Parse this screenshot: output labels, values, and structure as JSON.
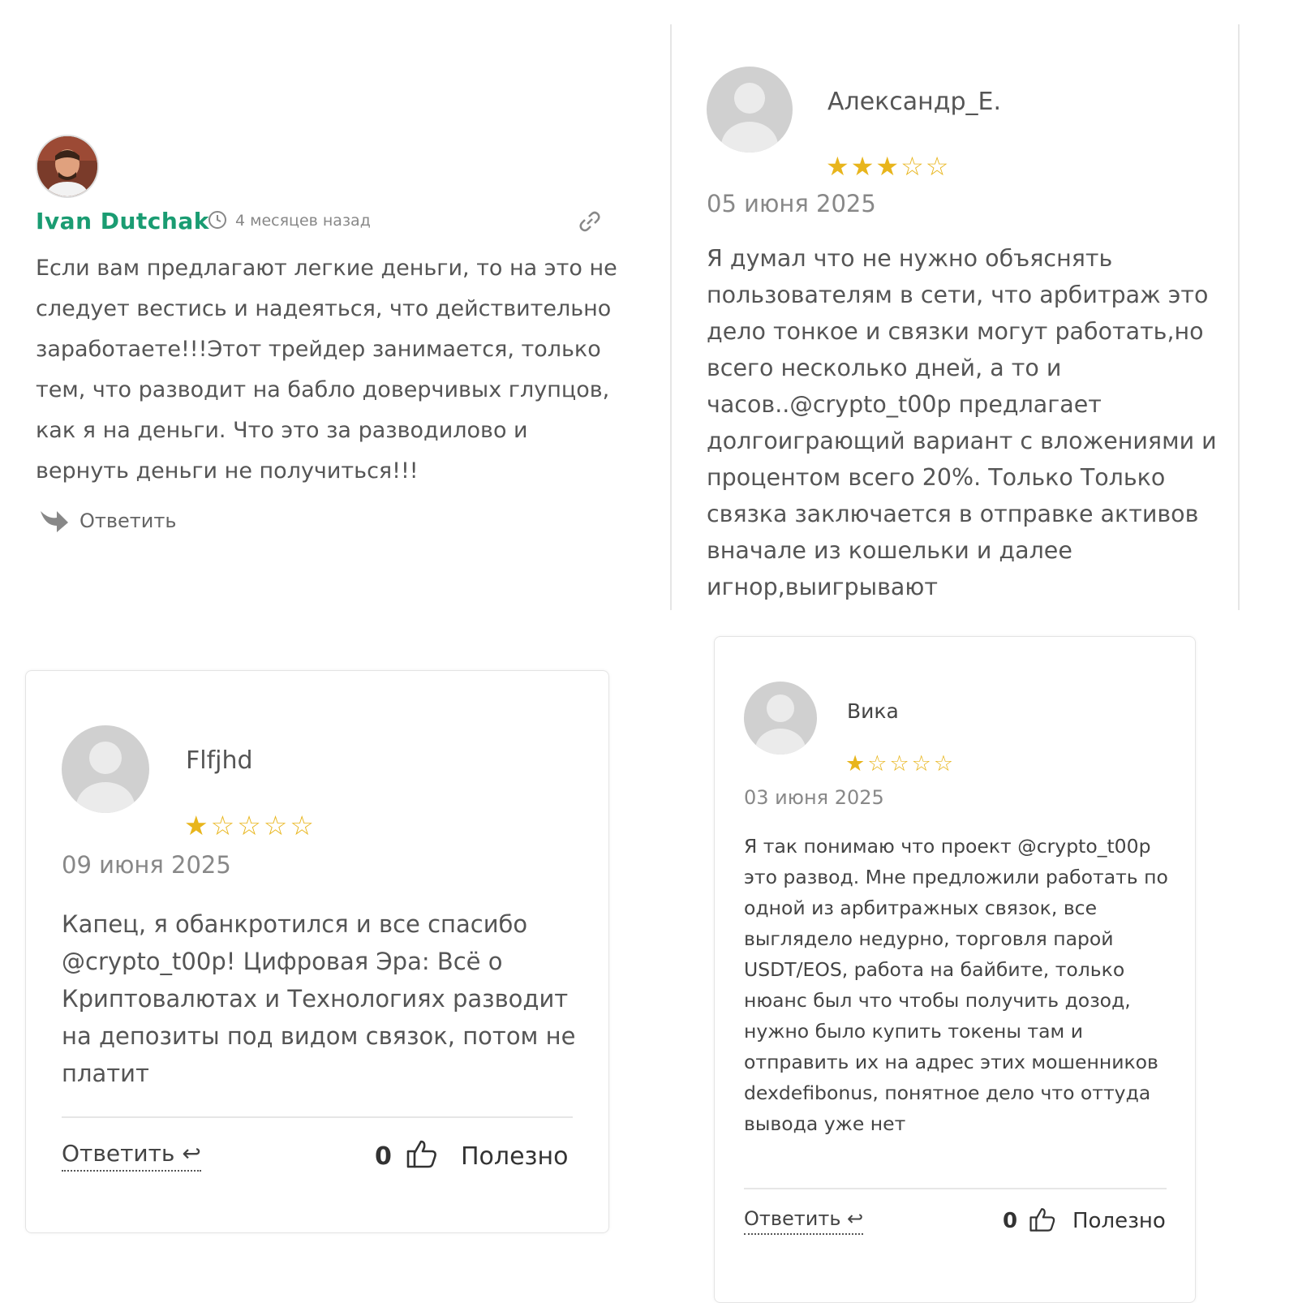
{
  "review_ivan": {
    "author": "Ivan Dutchak",
    "time": "4 месяцев назад",
    "text": "Если вам предлагают легкие деньги, то на это не следует вестись и надеяться, что действительно заработаете!!!Этот трейдер занимается, только тем, что разводит на бабло доверчивых глупцов, как я на деньги. Что это за разводилово и вернуть деньги не получиться!!!",
    "reply_label": "Ответить",
    "icons": [
      "avatar-photo",
      "clock-icon",
      "link-icon",
      "reply-arrow-icon"
    ]
  },
  "review_alexandr": {
    "author": "Александр_Е.",
    "rating": 3,
    "max_rating": 5,
    "date": "05 июня 2025",
    "text": "Я думал что не нужно объяснять пользователям в сети, что арбитраж это дело тонкое и связки могут работать,но всего несколько дней, а то и часов..@crypto_t00p предлагает долгоиграющий вариант с вложениями и процентом всего 20%. Только Только связка заключается в отправке активов вначале из кошельки и далее игнор,выигрывают"
  },
  "review_flfjhd": {
    "author": "Flfjhd",
    "rating": 1,
    "max_rating": 5,
    "date": "09 июня 2025",
    "text": "Капец, я обанкротился и все спасибо @crypto_t00p! Цифровая Эра: Всё о Криптовалютах и Технологиях разводит на депозиты под видом связок, потом не платит",
    "reply_label": "Ответить",
    "reply_icon": "↩",
    "likes": "0",
    "useful_label": "Полезно"
  },
  "review_vika": {
    "author": "Вика",
    "rating": 1,
    "max_rating": 5,
    "date": "03 июня 2025",
    "text": "Я так понимаю что проект @crypto_t00p это развод. Мне предложили работать по одной из арбитражных связок, все выглядело недурно, торговля парой USDT/EOS, работа на байбите, только нюанс был что чтобы получить дозод, нужно было купить токены там и отправить их на адрес этих мошенников dexdefibonus, понятное дело что оттуда вывода уже нет",
    "reply_label": "Ответить",
    "reply_icon": "↩",
    "likes": "0",
    "useful_label": "Полезно"
  },
  "colors": {
    "author_green": "#1a9c72",
    "star": "#e8b51c",
    "text": "#555555",
    "muted": "#888888"
  }
}
